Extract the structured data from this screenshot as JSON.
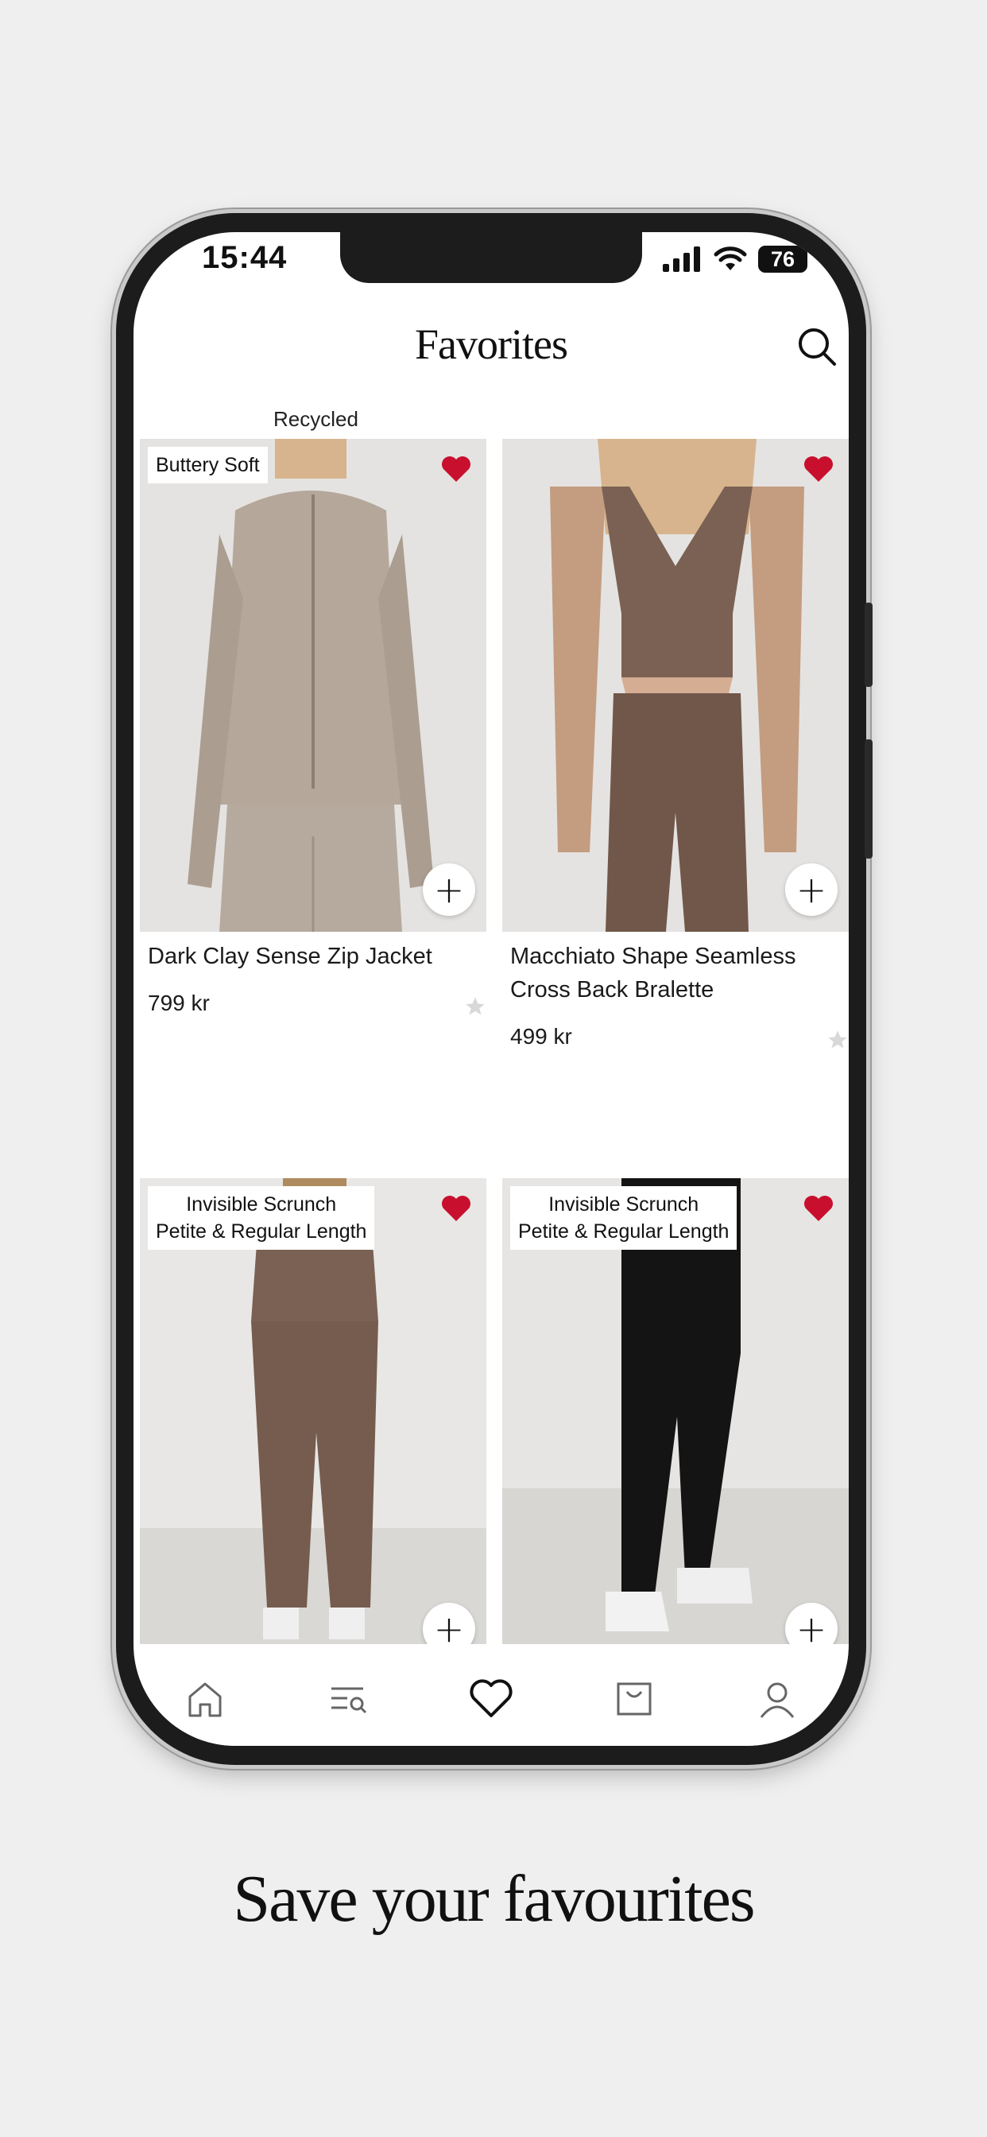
{
  "status_bar": {
    "time": "15:44",
    "battery": "76"
  },
  "header": {
    "title": "Favorites",
    "search_icon": "search-icon"
  },
  "top_label": "Recycled",
  "colors": {
    "favorite": "#c8102e",
    "background": "#efefef"
  },
  "products": [
    {
      "badge": [
        "Buttery Soft"
      ],
      "name": "Dark Clay Sense Zip Jacket",
      "price": "799 kr",
      "favorited": true
    },
    {
      "badge": [],
      "name": "Macchiato Shape Seamless Cross Back Bralette",
      "price": "499 kr",
      "favorited": true
    },
    {
      "badge": [
        "Invisible Scrunch",
        "Petite & Regular Length"
      ],
      "name": "",
      "price": "",
      "favorited": true
    },
    {
      "badge": [
        "Invisible Scrunch",
        "Petite & Regular Length"
      ],
      "name": "",
      "price": "",
      "favorited": true
    }
  ],
  "bottom_nav": [
    {
      "icon": "home-icon"
    },
    {
      "icon": "browse-icon"
    },
    {
      "icon": "heart-icon",
      "active": true
    },
    {
      "icon": "bag-icon"
    },
    {
      "icon": "profile-icon"
    }
  ],
  "caption": "Save your favourites"
}
